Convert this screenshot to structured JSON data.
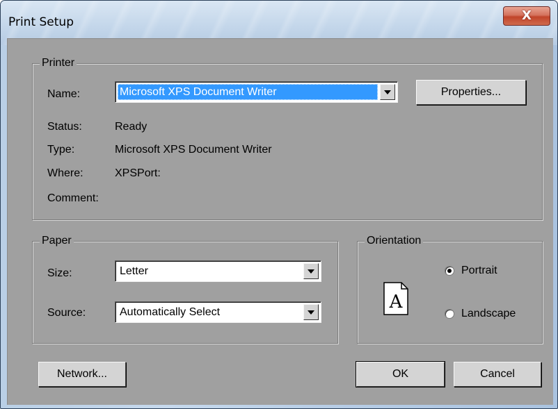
{
  "window": {
    "title": "Print Setup",
    "close_label": "X"
  },
  "printer": {
    "group_label": "Printer",
    "name_label": "Name:",
    "name_value": "Microsoft XPS Document Writer",
    "properties_label": "Properties...",
    "status_label": "Status:",
    "status_value": "Ready",
    "type_label": "Type:",
    "type_value": "Microsoft XPS Document Writer",
    "where_label": "Where:",
    "where_value": "XPSPort:",
    "comment_label": "Comment:",
    "comment_value": ""
  },
  "paper": {
    "group_label": "Paper",
    "size_label": "Size:",
    "size_value": "Letter",
    "source_label": "Source:",
    "source_value": "Automatically Select"
  },
  "orientation": {
    "group_label": "Orientation",
    "icon_letter": "A",
    "portrait_label": "Portrait",
    "landscape_label": "Landscape",
    "selected": "Portrait"
  },
  "buttons": {
    "network": "Network...",
    "ok": "OK",
    "cancel": "Cancel"
  }
}
